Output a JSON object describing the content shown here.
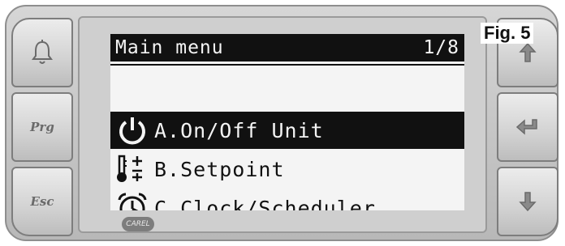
{
  "screen": {
    "title": "Main menu",
    "page_indicator": "1/8",
    "items": [
      {
        "label": "A.On/Off Unit",
        "icon": "power-icon",
        "selected": true
      },
      {
        "label": "B.Setpoint",
        "icon": "setpoint-thermometer-icon",
        "selected": false
      },
      {
        "label": "C.Clock/Scheduler",
        "icon": "clock-icon",
        "selected": false
      }
    ]
  },
  "keys": {
    "left": [
      {
        "name": "alarm",
        "icon": "bell-icon"
      },
      {
        "name": "prg",
        "label": "Prg"
      },
      {
        "name": "esc",
        "label": "Esc"
      }
    ],
    "right": [
      {
        "name": "up",
        "icon": "arrow-up-icon"
      },
      {
        "name": "enter",
        "icon": "enter-arrow-icon"
      },
      {
        "name": "down",
        "icon": "arrow-down-icon"
      }
    ]
  },
  "figure_label": "Fig. 5",
  "brand_logo": "CAREL",
  "colors": {
    "lcd_background": "#f4f4f4",
    "lcd_ink": "#111111",
    "bezel": "#c5c5c5"
  }
}
